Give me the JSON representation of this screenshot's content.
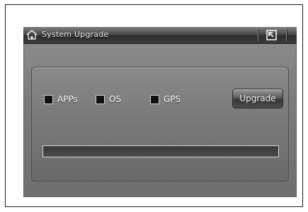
{
  "header": {
    "title": "System Upgrade",
    "home_icon": "home-icon",
    "back_icon": "back-arrow-icon"
  },
  "options": [
    {
      "label": "APPs",
      "checked": false
    },
    {
      "label": "OS",
      "checked": false
    },
    {
      "label": "GPS",
      "checked": false
    }
  ],
  "actions": {
    "upgrade_label": "Upgrade"
  },
  "progress": {
    "value": 0
  },
  "colors": {
    "background": "#7b7b7b",
    "titlebar": "#3b3b3b",
    "text": "#ffffff"
  }
}
